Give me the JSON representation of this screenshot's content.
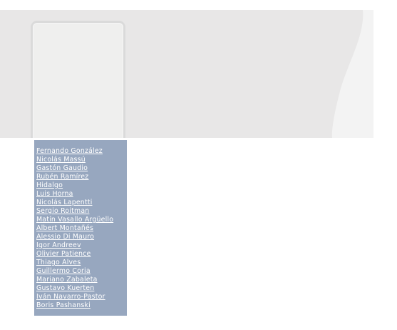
{
  "colors": {
    "page_background": "#ffffff",
    "banner_background": "#e8e7e7",
    "banner_curve": "#f3f3f3",
    "photo_frame_border": "#dadada",
    "photo_frame_fill": "#efefee",
    "list_background": "#97a7bf",
    "link_text": "#ffffff"
  },
  "players": [
    "Fernando González",
    "Nicolás Massú",
    "Gastón Gaudio",
    "Rubén Ramírez",
    "Hidalgo",
    "Luis Horna",
    "Nicolás Lapentti",
    "Sergio Roitman",
    "Matín Vasallo Argüello",
    "Albert Montañés",
    "Alessio Di Mauro",
    "Igor Andreev",
    "Olivier Patience",
    "Thiago Alves",
    "Guillermo Coria",
    "Mariano Zabaleta",
    "Gustavo Kuerten",
    "Iván Navarro-Pastor",
    "Boris Pashanski"
  ]
}
